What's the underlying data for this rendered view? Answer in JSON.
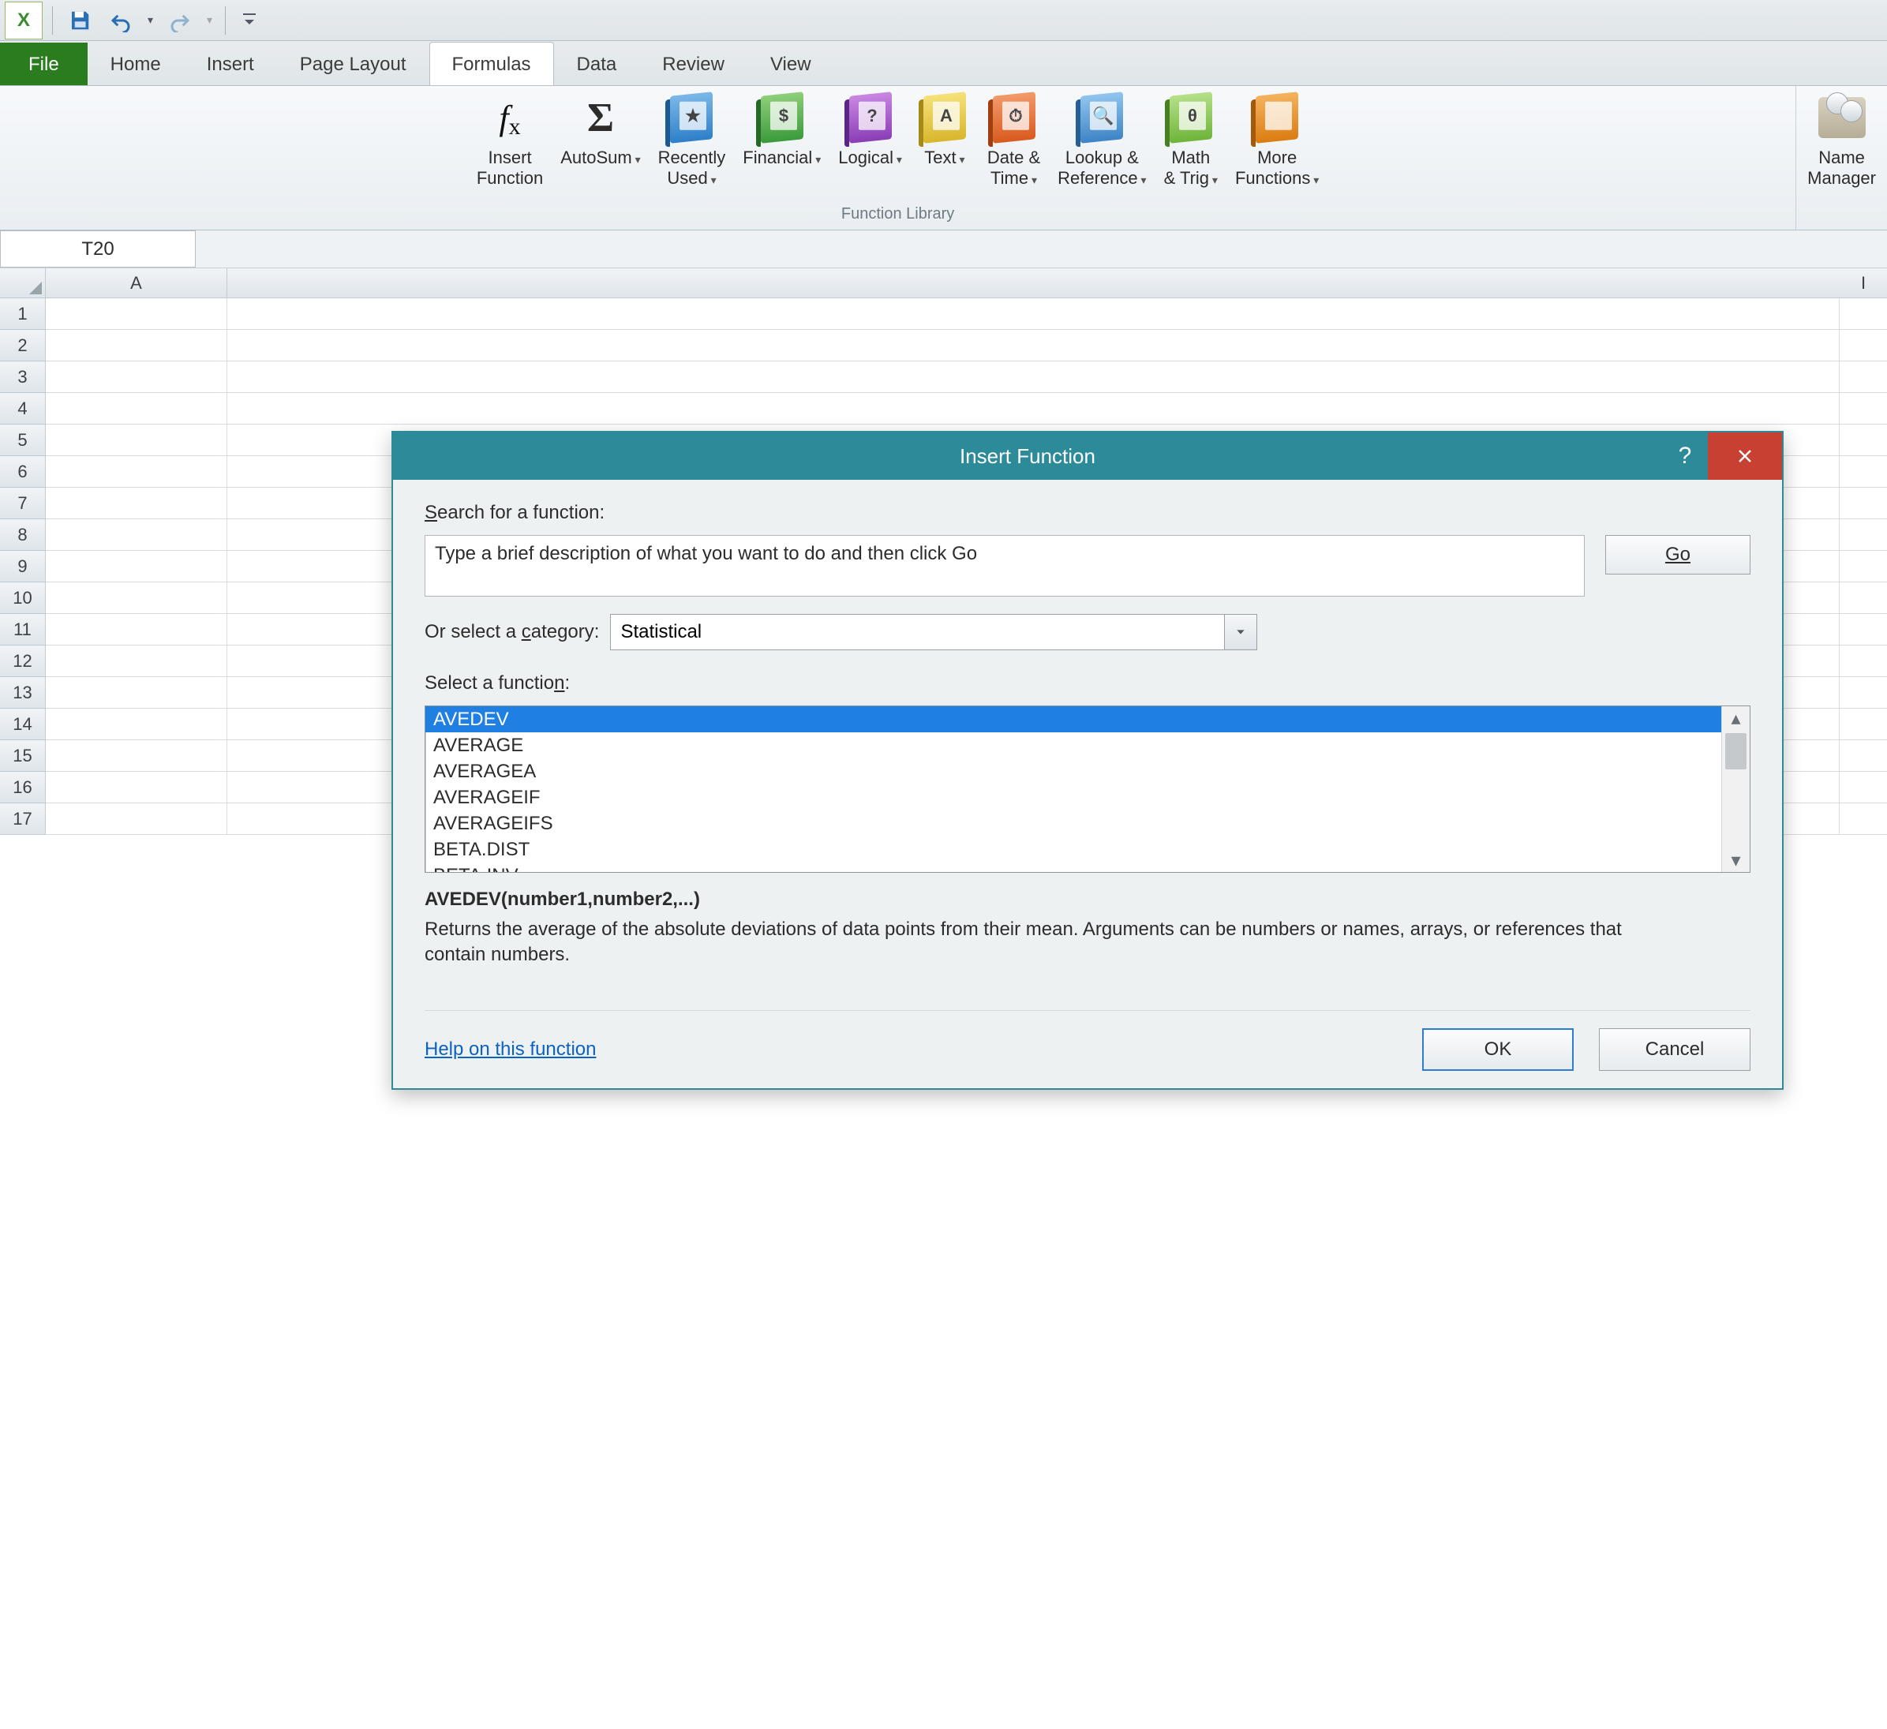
{
  "qat": {
    "undo_tip": "Undo",
    "redo_tip": "Redo",
    "save_tip": "Save"
  },
  "tabs": {
    "file": "File",
    "home": "Home",
    "insert": "Insert",
    "page_layout": "Page Layout",
    "formulas": "Formulas",
    "data": "Data",
    "review": "Review",
    "view": "View"
  },
  "ribbon": {
    "insert_function": "Insert\nFunction",
    "autosum": "AutoSum",
    "recently_used": "Recently\nUsed",
    "financial": "Financial",
    "logical": "Logical",
    "text": "Text",
    "date_time": "Date &\nTime",
    "lookup_ref": "Lookup &\nReference",
    "math_trig": "Math\n& Trig",
    "more_functions": "More\nFunctions",
    "name_manager": "Name\nManager",
    "group_function_library": "Function Library"
  },
  "namebox": "T20",
  "columns": [
    "A",
    "I"
  ],
  "rows": [
    "1",
    "2",
    "3",
    "4",
    "5",
    "6",
    "7",
    "8",
    "9",
    "10",
    "11",
    "12",
    "13",
    "14",
    "15",
    "16",
    "17"
  ],
  "dialog": {
    "title": "Insert Function",
    "search_label_pre": "S",
    "search_label_rest": "earch for a function:",
    "search_value": "Type a brief description of what you want to do and then click Go",
    "go": "Go",
    "cat_label_pre": "Or select a ",
    "cat_label_u": "c",
    "cat_label_post": "ategory:",
    "category": "Statistical",
    "select_label_pre": "Select a functio",
    "select_label_u": "n",
    "select_label_post": ":",
    "functions": [
      "AVEDEV",
      "AVERAGE",
      "AVERAGEA",
      "AVERAGEIF",
      "AVERAGEIFS",
      "BETA.DIST",
      "BETA.INV"
    ],
    "selected_index": 0,
    "signature": "AVEDEV(number1,number2,...)",
    "description": "Returns the average of the absolute deviations of data points from their mean. Arguments can be numbers or names, arrays, or references that contain numbers.",
    "help_link": "Help on this function",
    "ok": "OK",
    "cancel": "Cancel"
  }
}
